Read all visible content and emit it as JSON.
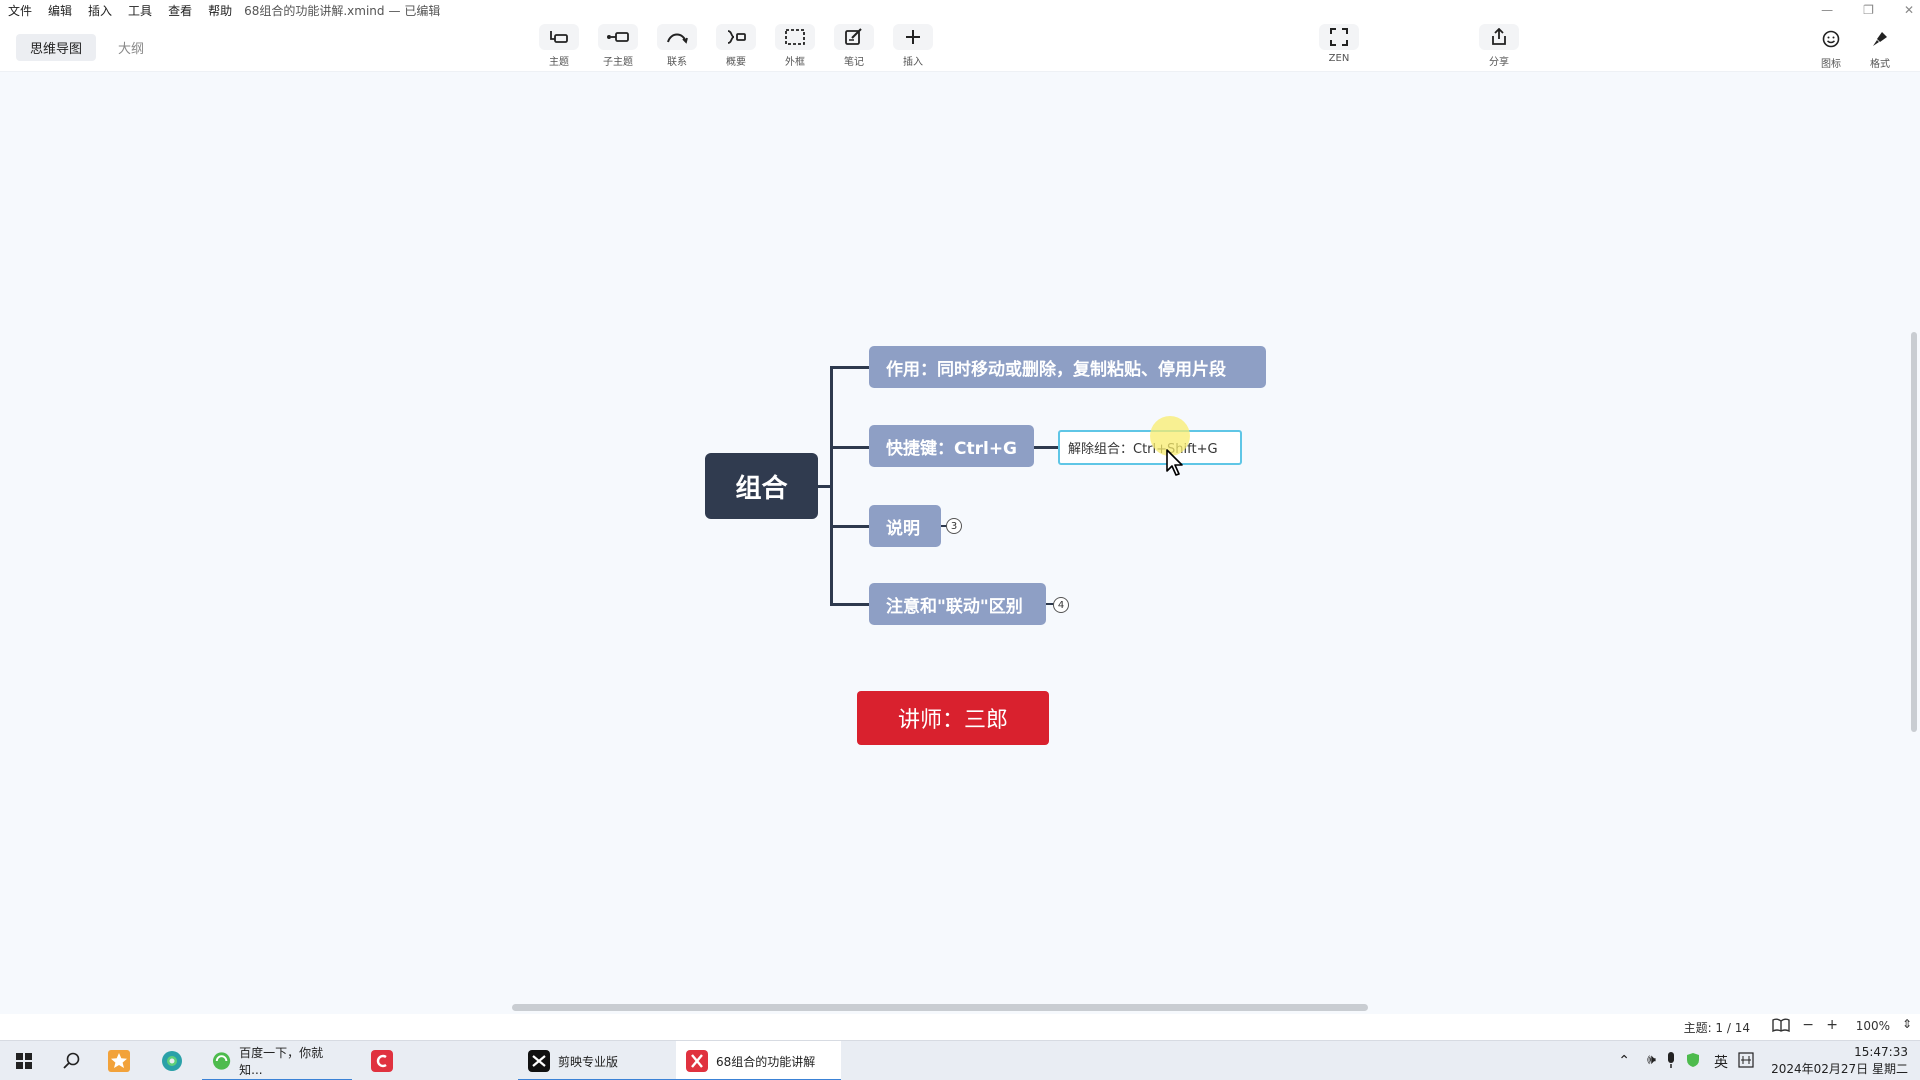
{
  "menubar": {
    "items": [
      "文件",
      "编辑",
      "插入",
      "工具",
      "查看",
      "帮助"
    ],
    "doc_title": "68组合的功能讲解.xmind",
    "doc_status": "— 已编辑"
  },
  "toolbar": {
    "view_tabs": [
      "思维导图",
      "大纲"
    ],
    "tools": {
      "topic": "主题",
      "subtopic": "子主题",
      "relationship": "联系",
      "summary": "概要",
      "boundary": "外框",
      "note": "笔记",
      "insert": "插入",
      "zen": "ZEN",
      "share": "分享",
      "icon": "图标",
      "format": "格式"
    }
  },
  "mindmap": {
    "central": "组合",
    "topics": [
      {
        "label": "作用：同时移动或删除，复制粘贴、停用片段"
      },
      {
        "label": "快捷键：Ctrl+G"
      },
      {
        "label": "说明",
        "collapsed_count": "3"
      },
      {
        "label": "注意和\"联动\"区别",
        "collapsed_count": "4"
      }
    ],
    "subtopic": "解除组合：Ctrl+Shift+G",
    "instructor": "讲师：三郎"
  },
  "statusbar": {
    "topic_count": "主题: 1 / 14",
    "zoom": "100%"
  },
  "taskbar": {
    "apps": [
      {
        "label": "百度一下，你就知..."
      },
      {
        "label": "剪映专业版"
      },
      {
        "label": "68组合的功能讲解"
      }
    ],
    "ime": "英",
    "time": "15:47:33",
    "date": "2024年02月27日 星期二"
  }
}
